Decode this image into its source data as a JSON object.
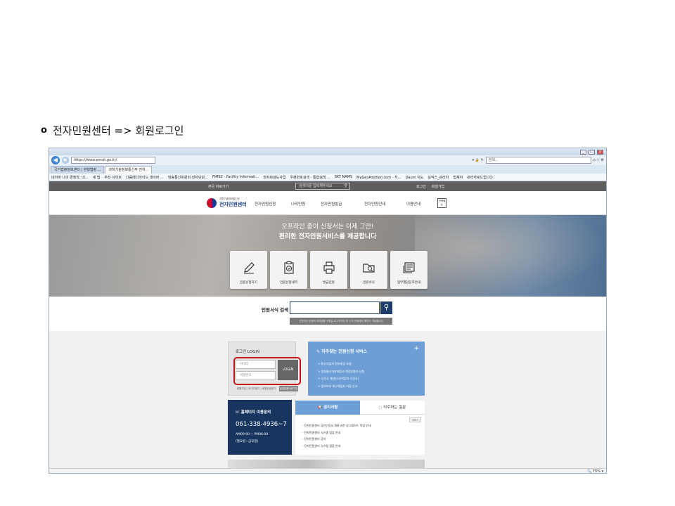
{
  "slide_heading": {
    "bullet": "o",
    "text": "전자민원센터 => 회원로그인"
  },
  "browser": {
    "url": "https://www.emsit.go.kr/",
    "search_placeholder": "검색...",
    "tabs": [
      {
        "label": "국가법령정보센터 | 현행법령 ..."
      },
      {
        "label": "과학기술정보통신부 전자..."
      }
    ],
    "favorites": [
      "네이버 나의 경정학, 네...",
      "새 탭",
      "추천 사이트",
      "다음메디아이드 네이버 ...",
      "방송통신위원회 전자민원...",
      "FIMS2 - Facility Informati...",
      "전자파검도사업",
      "우편번호검색 - 통합검색 ...",
      "SKT NAMS",
      "MyGeoPosition.com - 지...",
      "Daum 지도",
      "실적스_관리자",
      "법제처",
      "관리자로드입니다."
    ],
    "zoom": "75%"
  },
  "site": {
    "topbar": {
      "left": "본문 바로가기",
      "search_placeholder": "검색어를 입력해주세요",
      "login": "로그인",
      "join": "회원가입"
    },
    "logo": {
      "sub": "과학기술정보통신부",
      "main": "전자민원센터"
    },
    "nav": [
      "전자민원신청",
      "나의민원",
      "전자민원발급",
      "전자민원안내",
      "이용안내"
    ],
    "nav_box": "전체메뉴",
    "hero": {
      "line1": "오프라인 종이 신청서는 이제 그만!",
      "line2": "편리한 전자민원서비스를 제공합니다"
    },
    "services": [
      {
        "label": "민원신청하기",
        "icon": "pencil-icon"
      },
      {
        "label": "민원신청내역",
        "icon": "clipboard-check-icon"
      },
      {
        "label": "발급민원",
        "icon": "printer-icon"
      },
      {
        "label": "민원서식",
        "icon": "folder-search-icon"
      },
      {
        "label": "업무별담당자안내",
        "icon": "document-icon"
      }
    ],
    "search": {
      "label": "민원서식 검색",
      "hint": "신청하신 민원의 처리현황 사항은 로그인하신 후 나의 민원에서 확인이 가능합니다"
    },
    "login": {
      "title": "로그인 LOGIN",
      "id_placeholder": "아이디",
      "pw_placeholder": "비밀번호",
      "button": "LOGIN",
      "links": "회원가입 | 아이디찾기 | 비밀번호찾기",
      "join": "공인인증서로그인"
    },
    "frequent": {
      "title": "자주찾는 민원신청 서비스",
      "plus": "+",
      "items": [
        "> 통신기업자 정보제공 요청",
        "> 방송통신기자재등의 적합성평가 신청",
        "> 무선국 개설신고(위임자 무선국)",
        "> 정보보호 최고책임자 지정 신고"
      ]
    },
    "call": {
      "title": "홈페이지 이용문의",
      "number": "061-338-4936~7",
      "hours": "AM09:00 ~ PM06:00",
      "lunch": "(월요일~금요일)"
    },
    "notice": {
      "tab_notice": "공지사항",
      "tab_faq": "자주하는 질문",
      "more": "더보기",
      "items": [
        "· 전자민원센터 공인인증서 SW 버전 업그레이드 작업 안내",
        "· 전자민원센터 시스템 점검 안내",
        "· 전자민원센터 공지",
        "· 전자민원센터 시스템 점검 안내"
      ]
    }
  }
}
